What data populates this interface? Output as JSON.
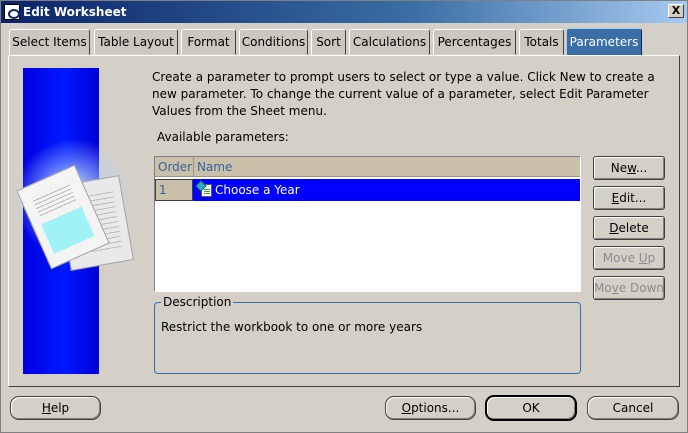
{
  "window": {
    "title": "Edit Worksheet",
    "close_label": "X"
  },
  "tabs": [
    {
      "label": "Select Items",
      "active": false
    },
    {
      "label": "Table Layout",
      "active": false
    },
    {
      "label": "Format",
      "active": false
    },
    {
      "label": "Conditions",
      "active": false
    },
    {
      "label": "Sort",
      "active": false
    },
    {
      "label": "Calculations",
      "active": false
    },
    {
      "label": "Percentages",
      "active": false
    },
    {
      "label": "Totals",
      "active": false
    },
    {
      "label": "Parameters",
      "active": true
    }
  ],
  "main": {
    "instructions": "Create a parameter to prompt users to select or type a value. Click New to create a new parameter. To change the current value of a parameter, select Edit Parameter Values from the Sheet menu.",
    "available_label": "Available parameters:",
    "columns": {
      "order": "Order",
      "name": "Name"
    },
    "rows": [
      {
        "order": "1",
        "name": "Choose a Year",
        "icon": "parameter-icon",
        "selected": true
      }
    ],
    "description": {
      "legend": "Description",
      "text": "Restrict the workbook to one or more years"
    }
  },
  "side_buttons": {
    "new": {
      "pre": "Ne",
      "key": "w",
      "post": "..."
    },
    "edit": {
      "pre": "",
      "key": "E",
      "post": "dit..."
    },
    "delete": {
      "pre": "",
      "key": "D",
      "post": "elete"
    },
    "move_up": {
      "pre": "Move ",
      "key": "U",
      "post": "p",
      "enabled": false
    },
    "move_down": {
      "pre": "Mo",
      "key": "v",
      "post": "e Down",
      "enabled": false
    }
  },
  "footer": {
    "help": {
      "pre": "",
      "key": "H",
      "post": "elp"
    },
    "options": {
      "pre": "",
      "key": "O",
      "post": "ptions..."
    },
    "ok": "OK",
    "cancel": "Cancel"
  },
  "colors": {
    "title_bar": "#0a246a",
    "active_tab": "#3a6ea5",
    "selected_row": "#0000ff",
    "side_art": "#0018ff"
  }
}
